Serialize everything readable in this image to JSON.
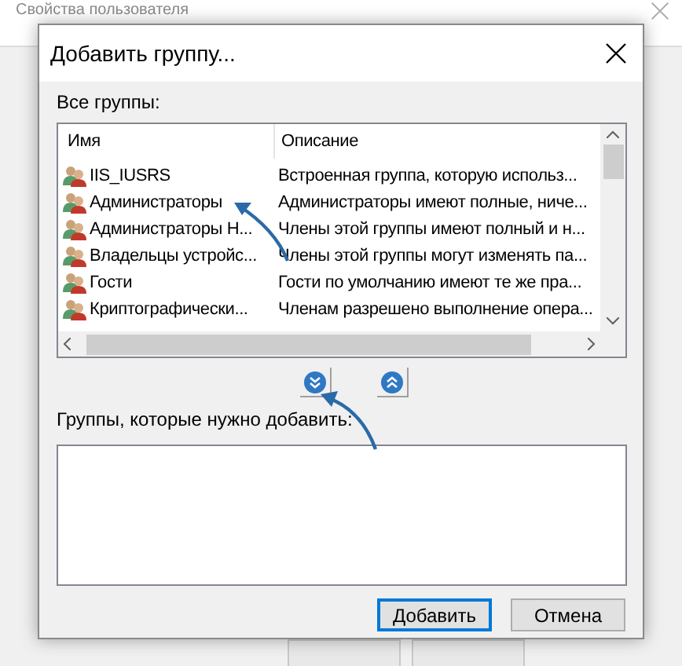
{
  "background_window": {
    "title": "Свойства пользователя"
  },
  "dialog": {
    "title": "Добавить группу...",
    "all_groups_label": "Все группы:",
    "columns": [
      "Имя",
      "Описание"
    ],
    "rows": [
      {
        "name": "IIS_IUSRS",
        "description": "Встроенная группа, которую использ..."
      },
      {
        "name": "Администраторы",
        "description": "Администраторы имеют полные, ниче..."
      },
      {
        "name": "Администраторы H...",
        "description": "Члены этой группы имеют полный и н..."
      },
      {
        "name": "Владельцы устройс...",
        "description": "Члены этой группы могут изменять па..."
      },
      {
        "name": "Гости",
        "description": "Гости по умолчанию имеют те же пра..."
      },
      {
        "name": "Криптографически...",
        "description": "Членам разрешено выполнение опера..."
      }
    ],
    "to_add_label": "Группы, которые нужно добавить:",
    "buttons": [
      {
        "label": "Добавить",
        "default": true
      },
      {
        "label": "Отмена",
        "default": false
      }
    ]
  }
}
